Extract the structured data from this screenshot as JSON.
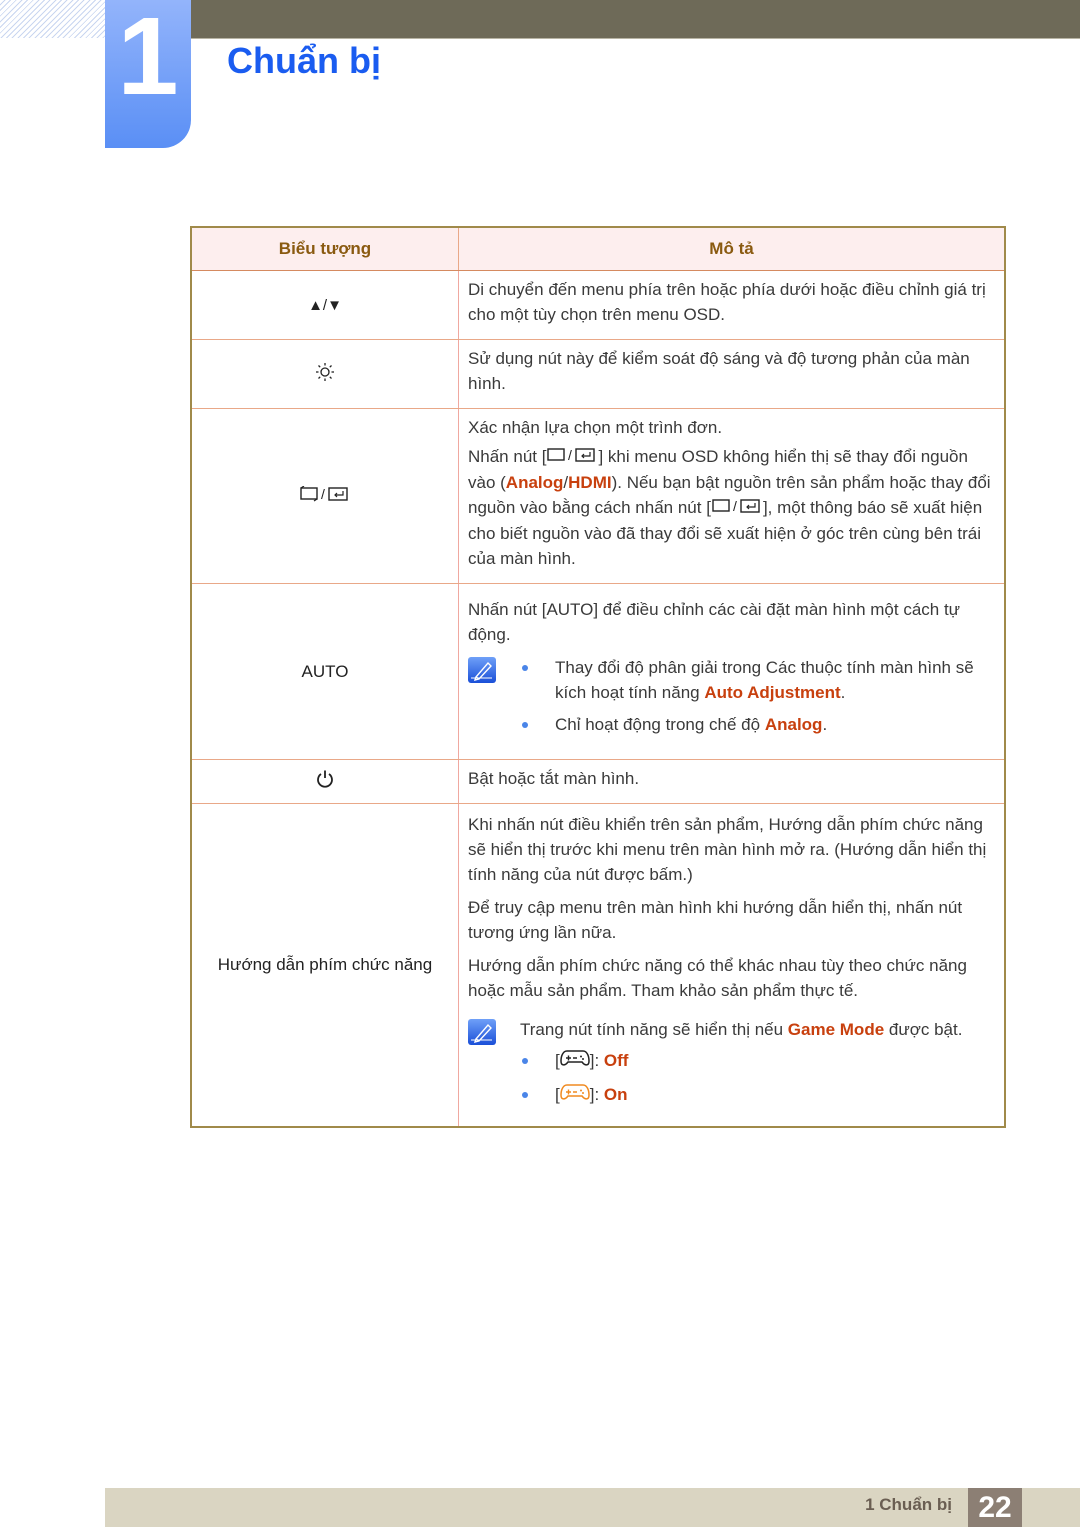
{
  "header": {
    "chapter_number": "1",
    "chapter_title": "Chuẩn bị"
  },
  "table": {
    "columns": [
      "Biểu tượng",
      "Mô tả"
    ],
    "rows": [
      {
        "icon": "up-down-arrows-icon",
        "icon_text": "▲/▼",
        "paragraphs": [
          "Di chuyển đến menu phía trên hoặc phía dưới hoặc điều chỉnh giá trị cho một tùy chọn trên menu OSD."
        ]
      },
      {
        "icon": "brightness-icon",
        "paragraphs": [
          "Sử dụng nút này để kiểm soát độ sáng và độ tương phản của màn hình."
        ]
      },
      {
        "icon": "enter-source-icon",
        "p1": "Xác nhận lựa chọn một trình đơn.",
        "p2_a": "Nhấn nút [",
        "p2_b": "] khi menu OSD không hiển thị sẽ thay đổi nguồn vào (",
        "p2_analog": "Analog",
        "p2_slash": "/",
        "p2_hdmi": "HDMI",
        "p2_c": "). Nếu bạn bật nguồn trên sản phẩm hoặc thay đổi nguồn vào bằng cách nhấn nút [",
        "p2_d": "], một thông báo sẽ xuất hiện cho biết nguồn vào đã thay đổi sẽ xuất hiện ở góc trên cùng bên trái của màn hình."
      },
      {
        "icon_text": "AUTO",
        "p1": "Nhấn nút [AUTO] để điều chỉnh các cài đặt màn hình một cách tự động.",
        "note_bullets": [
          {
            "text": "Thay đổi độ phân giải trong Các thuộc tính màn hình sẽ kích hoạt tính năng ",
            "highlight": "Auto Adjustment",
            "suffix": "."
          },
          {
            "text": "Chỉ hoạt động trong chế độ ",
            "highlight": "Analog",
            "suffix": "."
          }
        ]
      },
      {
        "icon": "power-icon",
        "paragraphs": [
          "Bật hoặc tắt màn hình."
        ]
      },
      {
        "icon_text": "Hướng dẫn phím chức năng",
        "paragraphs": [
          "Khi nhấn nút điều khiển trên sản phẩm, Hướng dẫn phím chức năng sẽ hiển thị trước khi menu trên màn hình mở ra. (Hướng dẫn hiển thị tính năng của nút được bấm.)",
          "Để truy cập menu trên màn hình khi hướng dẫn hiển thị, nhấn nút tương ứng lần nữa.",
          "Hướng dẫn phím chức năng có thể khác nhau tùy theo chức năng hoặc mẫu sản phẩm. Tham khảo sản phẩm thực tế."
        ],
        "note_text": "Trang nút tính năng sẽ hiển thị nếu ",
        "note_highlight": "Game Mode",
        "note_suffix": " được bật.",
        "states": [
          {
            "icon": "gamepad-off-icon",
            "label": "Off",
            "color": "#222222"
          },
          {
            "icon": "gamepad-on-icon",
            "label": "On",
            "color": "#f08a20"
          }
        ]
      }
    ]
  },
  "footer": {
    "section": "1 Chuẩn bị",
    "page": "22"
  },
  "colors": {
    "title_blue": "#1a5cf0",
    "highlight": "#c8400e",
    "header_text": "#8a5a10",
    "header_bg": "#fdeeee"
  }
}
